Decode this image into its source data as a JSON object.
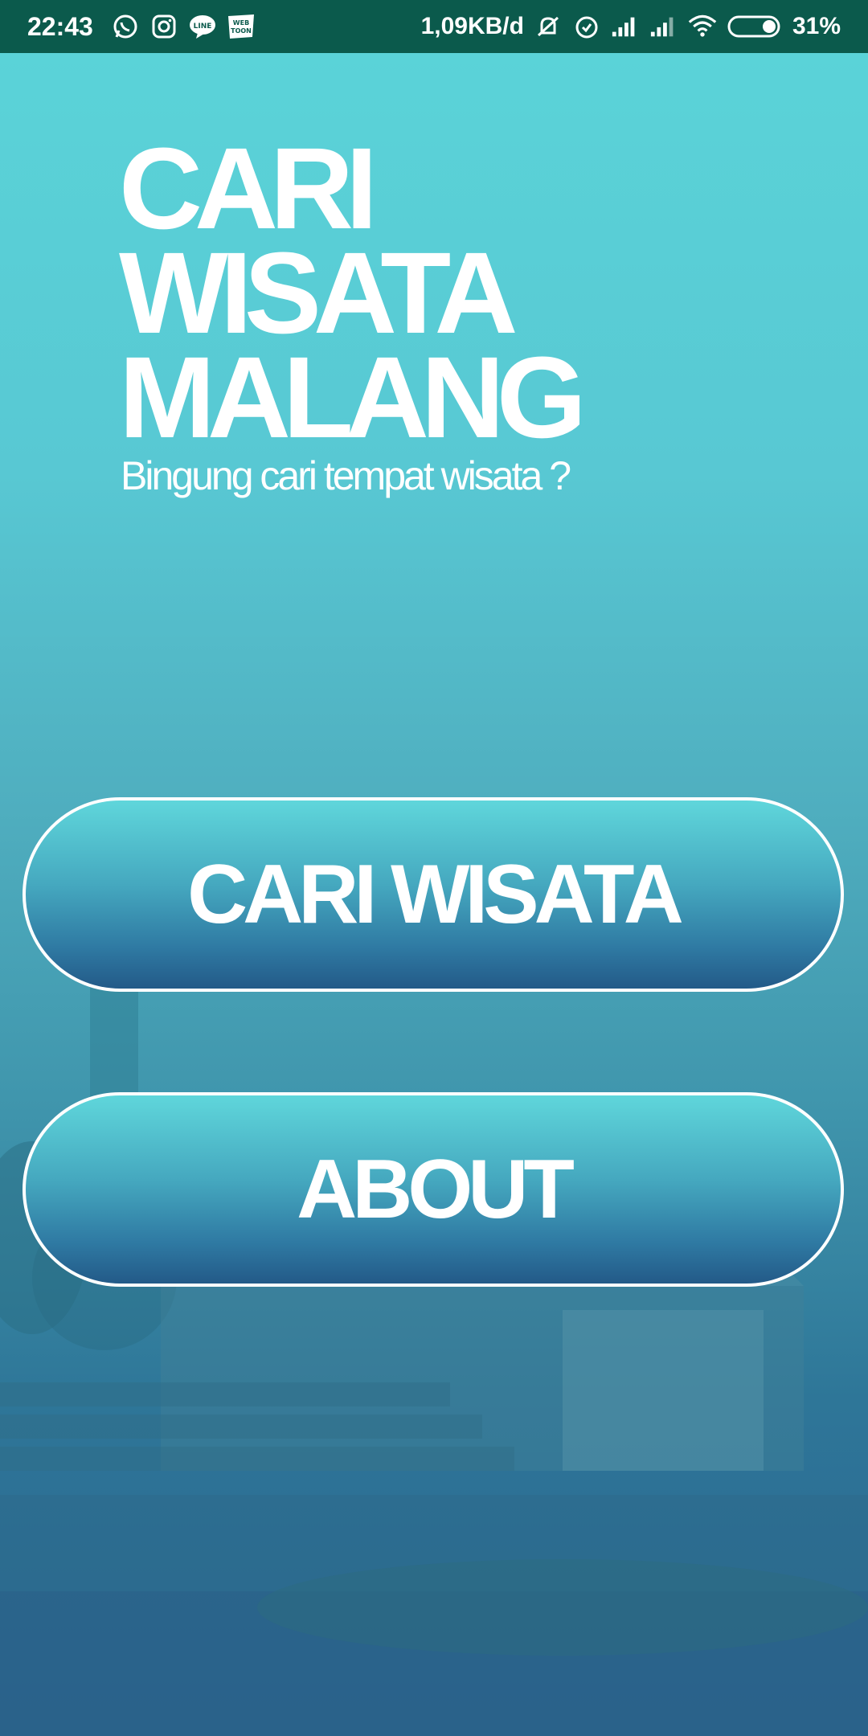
{
  "status_bar": {
    "time": "22:43",
    "notification_icons": [
      "whatsapp-icon",
      "instagram-icon",
      "line-icon",
      "webtoon-icon"
    ],
    "network_speed": "1,09KB/d",
    "status_icons": [
      "mute-icon",
      "alarm-icon",
      "signal-icon",
      "signal-icon",
      "wifi-icon",
      "battery-icon"
    ],
    "battery": "31%",
    "background_color": "#0b5a4c"
  },
  "header": {
    "title_lines": [
      "CARI",
      "WISATA",
      "MALANG"
    ],
    "subtitle": "Bingung cari tempat wisata ?"
  },
  "buttons": {
    "cari_wisata": "CARI WISATA",
    "about": "ABOUT"
  },
  "colors": {
    "accent": "#5ad3d8",
    "dark": "#235a88",
    "text": "#ffffff"
  }
}
